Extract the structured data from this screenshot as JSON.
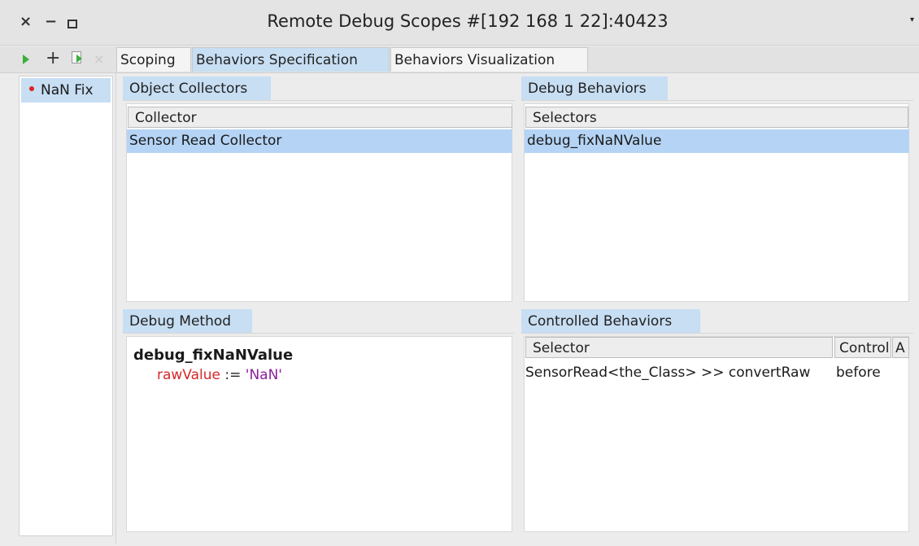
{
  "window": {
    "title": "Remote Debug Scopes #[192 168 1 22]:40423",
    "close_glyph": "×",
    "minimize_glyph": "−",
    "menu_glyph": "▾"
  },
  "toolbar": {
    "icons": [
      "play-icon",
      "add-icon",
      "edit-document-icon",
      "remove-icon"
    ],
    "plus_glyph": "+",
    "remove_glyph": "×"
  },
  "tabs": [
    {
      "label": "Scoping"
    },
    {
      "label": "Behaviors Specification",
      "selected": true
    },
    {
      "label": "Behaviors Visualization"
    }
  ],
  "scopes": [
    {
      "label": "NaN Fix",
      "status_color": "#e02020"
    }
  ],
  "object_collectors": {
    "title": "Object Collectors",
    "column": "Collector",
    "rows": [
      "Sensor Read Collector"
    ]
  },
  "debug_behaviors": {
    "title": "Debug Behaviors",
    "column": "Selectors",
    "rows": [
      "debug_fixNaNValue"
    ]
  },
  "debug_method": {
    "title": "Debug Method",
    "method_name": "debug_fixNaNValue",
    "var": "rawValue",
    "op": " := ",
    "value": "'NaN'"
  },
  "controlled_behaviors": {
    "title": "Controlled Behaviors",
    "columns": [
      "Selector",
      "Control",
      "A"
    ],
    "rows": [
      {
        "selector": "SensorRead<the_Class> >> convertRaw",
        "control": "before"
      }
    ]
  },
  "colors": {
    "selection": "#b5d4f5",
    "tab_selected": "#c7def3",
    "play_green": "#3dae3d",
    "var_red": "#d62828",
    "string_purple": "#8a1f9c"
  }
}
